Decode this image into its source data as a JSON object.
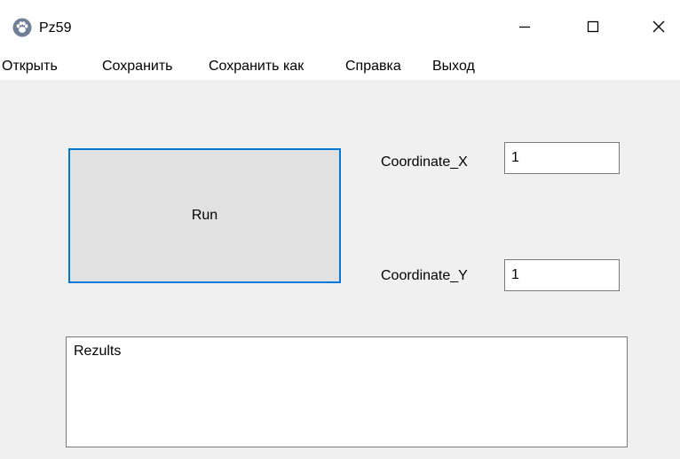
{
  "window": {
    "title": "Pz59",
    "icon": "paw-icon",
    "controls": {
      "minimize_icon": "minimize-icon",
      "maximize_icon": "maximize-icon",
      "close_icon": "close-icon"
    }
  },
  "menu": {
    "items": [
      {
        "label": "Открыть"
      },
      {
        "label": "Сохранить"
      },
      {
        "label": "Сохранить как"
      },
      {
        "label": "Справка"
      },
      {
        "label": "Выход"
      }
    ]
  },
  "form": {
    "run_label": "Run",
    "coordinate_x": {
      "label": "Coordinate_X",
      "value": "1"
    },
    "coordinate_y": {
      "label": "Coordinate_Y",
      "value": "1"
    },
    "results": {
      "text": "Rezults"
    }
  },
  "colors": {
    "focus_border": "#0078d7",
    "button_face": "#e1e1e1",
    "window_background": "#f0f0f0"
  }
}
